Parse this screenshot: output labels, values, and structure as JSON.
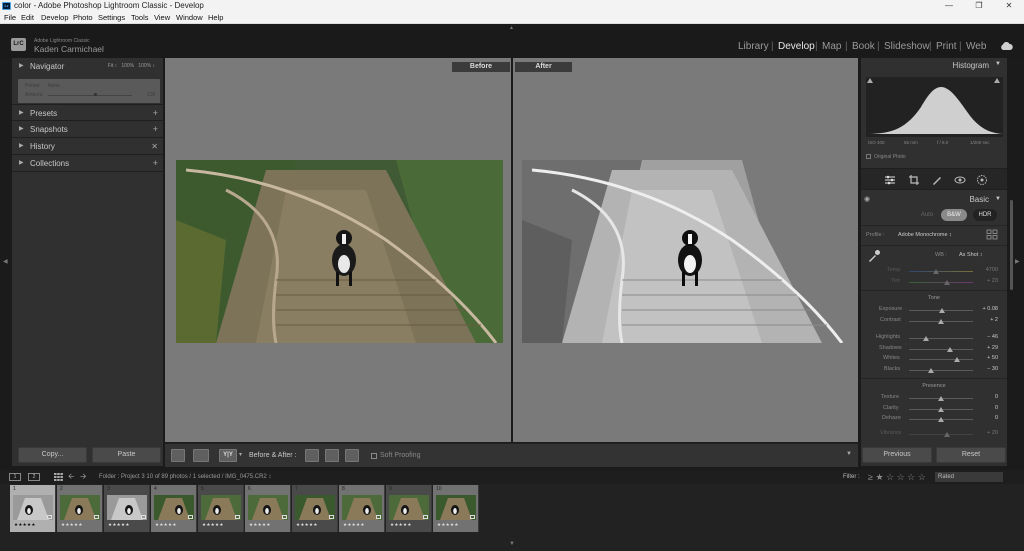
{
  "window": {
    "title": "color - Adobe Photoshop Lightroom Classic - Develop",
    "app_icon": "Lr"
  },
  "menu": [
    "File",
    "Edit",
    "Develop",
    "Photo",
    "Settings",
    "Tools",
    "View",
    "Window",
    "Help"
  ],
  "identity": {
    "badge": "LrC",
    "product": "Adobe Lightroom Classic",
    "user": "Kaden Carmichael"
  },
  "modules": [
    "Library",
    "Develop",
    "Map",
    "Book",
    "Slideshow",
    "Print",
    "Web"
  ],
  "active_module": "Develop",
  "left_panel": {
    "navigator": {
      "label": "Navigator",
      "zoom_fit": "Fit ↕",
      "zoom_a": "100%",
      "zoom_b": "100% ↕"
    },
    "preset_box": {
      "preset_label": "Preset",
      "preset_value": "None",
      "amount_label": "Amount",
      "amount_value": "100"
    },
    "sections": [
      "Presets",
      "Snapshots",
      "History",
      "Collections"
    ],
    "copy_button": "Copy...",
    "paste_button": "Paste"
  },
  "view": {
    "before_label": "Before",
    "after_label": "After"
  },
  "toolbar": {
    "yy_label": "Y|Y",
    "before_after_label": "Before & After :",
    "soft_proofing_label": "Soft Proofing"
  },
  "right_panel": {
    "histogram_label": "Histogram",
    "hist_info": [
      "ISO 400",
      "55 mm",
      "f / 8.0",
      "1/200 sec"
    ],
    "original_photo_label": "Original Photo",
    "basic_label": "Basic",
    "treatment": [
      "Auto",
      "B&W",
      "HDR"
    ],
    "profile_label": "Profile :",
    "profile_value": "Adobe Monochrome ↕",
    "wb_label": "WB :",
    "wb_value": "As Shot ↕",
    "temp": {
      "label": "Temp",
      "value": "4700",
      "level": 0.42
    },
    "tint": {
      "label": "Tint",
      "value": "+ 23",
      "level": 0.6
    },
    "tone_label": "Tone",
    "tone_auto": "Auto",
    "exposure": {
      "label": "Exposure",
      "value": "+ 0.08",
      "level": 0.51
    },
    "contrast": {
      "label": "Contrast",
      "value": "+ 2",
      "level": 0.5
    },
    "highlights": {
      "label": "Highlights",
      "value": "− 46",
      "level": 0.27
    },
    "shadows": {
      "label": "Shadows",
      "value": "+ 29",
      "level": 0.64
    },
    "whites": {
      "label": "Whites",
      "value": "+ 50",
      "level": 0.75
    },
    "blacks": {
      "label": "Blacks",
      "value": "− 30",
      "level": 0.35
    },
    "presence_label": "Presence",
    "texture": {
      "label": "Texture",
      "value": "0",
      "level": 0.5
    },
    "clarity": {
      "label": "Clarity",
      "value": "0",
      "level": 0.5
    },
    "dehaze": {
      "label": "Dehaze",
      "value": "0",
      "level": 0.5
    },
    "vibrance": {
      "label": "Vibrance",
      "value": "+ 20",
      "level": 0.6
    },
    "previous_button": "Previous",
    "reset_button": "Reset"
  },
  "filmstrip": {
    "monitor_1": "1",
    "monitor_2": "2",
    "path": "Folder : Project 3      10 of 89 photos / 1 selected / IMG_0475.CR2 ↕",
    "filter_label": "Filter :",
    "filter_stars": "≥ ★ ☆ ☆ ☆ ☆",
    "rated": "Rated",
    "thumbs": [
      {
        "num": "1",
        "stars": "★★★★★",
        "tone": "bw",
        "selected": true
      },
      {
        "num": "2",
        "stars": "★★★★★",
        "tone": "color"
      },
      {
        "num": "3",
        "stars": "★★★★★",
        "tone": "bw"
      },
      {
        "num": "4",
        "stars": "★★★★★",
        "tone": "color"
      },
      {
        "num": "5",
        "stars": "★★★★★",
        "tone": "color"
      },
      {
        "num": "6",
        "stars": "★★★★★",
        "tone": "color"
      },
      {
        "num": "7",
        "stars": "★★★★★",
        "tone": "color"
      },
      {
        "num": "8",
        "stars": "★★★★★",
        "tone": "color"
      },
      {
        "num": "9",
        "stars": "★★★★★",
        "tone": "color"
      },
      {
        "num": "10",
        "stars": "★★★★★",
        "tone": "color"
      }
    ]
  },
  "colors": {
    "panel": "#303030",
    "background": "#1b1b1b",
    "center_gray": "#7a7a7a",
    "active_module": "#e6e6e6"
  }
}
